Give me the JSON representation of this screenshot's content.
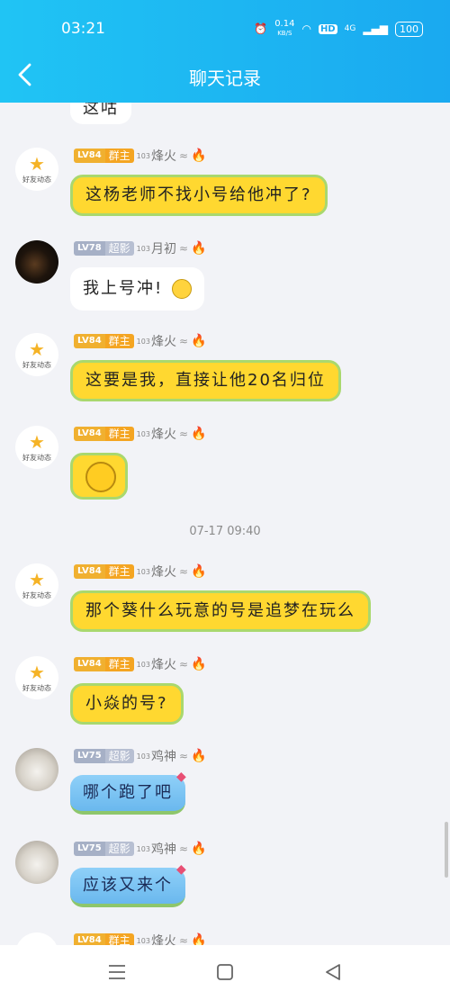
{
  "status_bar": {
    "time": "03:21",
    "speed": "0.14",
    "speed_unit": "KB/S",
    "hd": "HD",
    "network": "4G",
    "battery": "100"
  },
  "header": {
    "title": "聊天记录"
  },
  "feed_label": "好友动态",
  "partial_top_text": "这咕",
  "messages": [
    {
      "lv": "LV84",
      "role": "群主",
      "num": "103",
      "name": "烽火",
      "text": "这杨老师不找小号给他冲了?"
    },
    {
      "lv": "LV78",
      "role": "超影",
      "num": "103",
      "name": "月初",
      "text": "我上号冲!"
    },
    {
      "lv": "LV84",
      "role": "群主",
      "num": "103",
      "name": "烽火",
      "text": "这要是我，直接让他20名归位"
    },
    {
      "lv": "LV84",
      "role": "群主",
      "num": "103",
      "name": "烽火",
      "text": ""
    },
    {
      "lv": "LV84",
      "role": "群主",
      "num": "103",
      "name": "烽火",
      "text": "那个葵什么玩意的号是追梦在玩么"
    },
    {
      "lv": "LV84",
      "role": "群主",
      "num": "103",
      "name": "烽火",
      "text": "小焱的号?"
    },
    {
      "lv": "LV75",
      "role": "超影",
      "num": "103",
      "name": "鸡神",
      "text": "哪个跑了吧"
    },
    {
      "lv": "LV75",
      "role": "超影",
      "num": "103",
      "name": "鸡神",
      "text": "应该又来个"
    },
    {
      "lv": "LV84",
      "role": "群主",
      "num": "103",
      "name": "烽火",
      "text": ""
    }
  ],
  "time_separator": "07-17 09:40",
  "colors": {
    "header_start": "#20c4f4",
    "header_end": "#1aa9f0",
    "bubble_yellow": "#ffd830",
    "bubble_border": "#a9d86e",
    "background": "#f2f3f7"
  }
}
